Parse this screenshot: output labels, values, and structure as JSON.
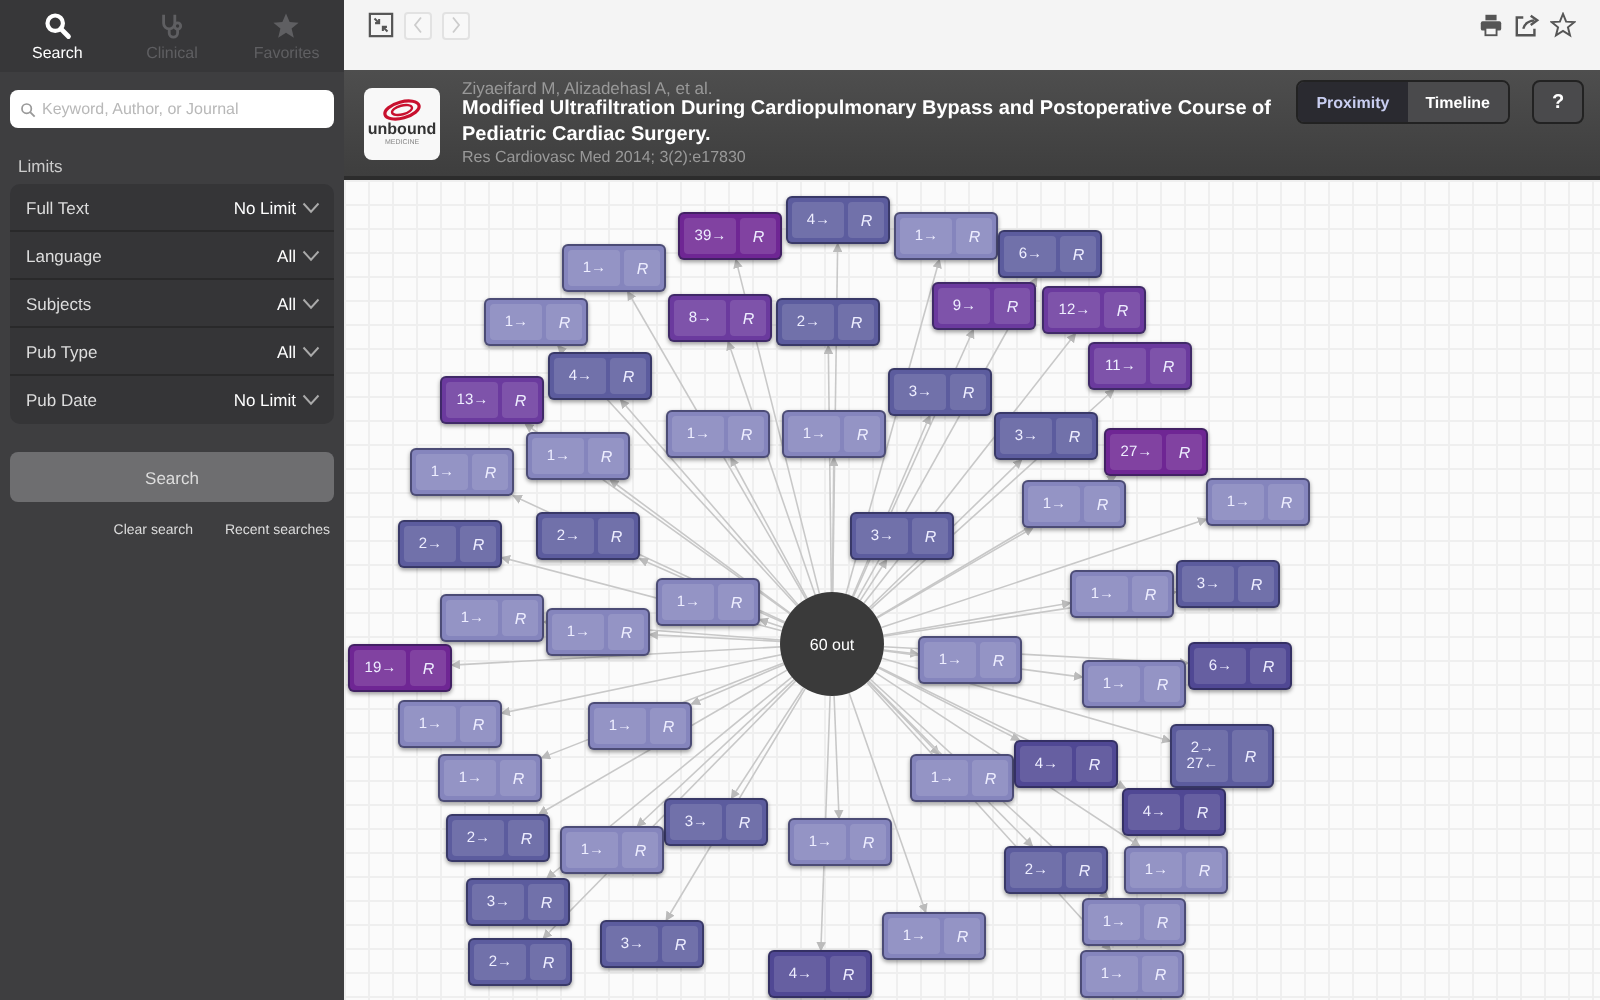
{
  "sidebar": {
    "tabs": [
      {
        "label": "Search",
        "kind": "search",
        "selected": true
      },
      {
        "label": "Clinical",
        "kind": "clinical",
        "selected": false
      },
      {
        "label": "Favorites",
        "kind": "favorites",
        "selected": false
      }
    ],
    "search_field": {
      "placeholder": "Keyword, Author, or Journal"
    },
    "limits_heading": "Limits",
    "limits": [
      {
        "label": "Full Text",
        "value": "No Limit"
      },
      {
        "label": "Language",
        "value": "All"
      },
      {
        "label": "Subjects",
        "value": "All"
      },
      {
        "label": "Pub Type",
        "value": "All"
      },
      {
        "label": "Pub Date",
        "value": "No Limit"
      }
    ],
    "search_button": "Search",
    "links": [
      "Clear search",
      "Recent searches"
    ]
  },
  "toolbar": {
    "nav": [
      {
        "kind": "back",
        "disabled": true
      },
      {
        "kind": "forward",
        "disabled": true
      }
    ]
  },
  "article": {
    "logo": {
      "name": "unbound",
      "tagline": "MEDICINE"
    },
    "authors": "Ziyaeifard M, Alizadehasl A, et al.",
    "title": "Modified Ultrafiltration During Cardiopulmonary Bypass and Postoperative Course of Pediatric Cardiac Surgery.",
    "citation": "Res Cardiovasc Med 2014; 3(2):e17830"
  },
  "view_modes": [
    {
      "label": "Proximity",
      "selected": true
    },
    {
      "label": "Timeline",
      "selected": false
    }
  ],
  "help": "?",
  "graph": {
    "center": "60 out",
    "nodes": [
      {
        "counts": [
          "39→"
        ],
        "action": "R",
        "color": "#6f2694"
      },
      {
        "counts": [
          "4→"
        ],
        "action": "R",
        "color": "#5c5c9e"
      },
      {
        "counts": [
          "1→"
        ],
        "action": "R",
        "color": "#8585bd"
      },
      {
        "counts": [
          "6→"
        ],
        "action": "R",
        "color": "#5c5c9e"
      },
      {
        "counts": [
          "1→"
        ],
        "action": "R",
        "color": "#8585bd"
      },
      {
        "counts": [
          "8→"
        ],
        "action": "R",
        "color": "#6b3a9e"
      },
      {
        "counts": [
          "2→"
        ],
        "action": "R",
        "color": "#5c5c9e"
      },
      {
        "counts": [
          "9→"
        ],
        "action": "R",
        "color": "#6b3a9e"
      },
      {
        "counts": [
          "12→"
        ],
        "action": "R",
        "color": "#6b3a9e"
      },
      {
        "counts": [
          "1→"
        ],
        "action": "R",
        "color": "#8585bd"
      },
      {
        "counts": [
          "4→"
        ],
        "action": "R",
        "color": "#5c5c9e"
      },
      {
        "counts": [
          "11→"
        ],
        "action": "R",
        "color": "#6b3a9e"
      },
      {
        "counts": [
          "13→"
        ],
        "action": "R",
        "color": "#6b3a9e"
      },
      {
        "counts": [
          "3→"
        ],
        "action": "R",
        "color": "#5c5c9e"
      },
      {
        "counts": [
          "1→"
        ],
        "action": "R",
        "color": "#8585bd"
      },
      {
        "counts": [
          "1→"
        ],
        "action": "R",
        "color": "#8585bd"
      },
      {
        "counts": [
          "3→"
        ],
        "action": "R",
        "color": "#5c5c9e"
      },
      {
        "counts": [
          "27→"
        ],
        "action": "R",
        "color": "#6f2694"
      },
      {
        "counts": [
          "1→"
        ],
        "action": "R",
        "color": "#8585bd"
      },
      {
        "counts": [
          "1→"
        ],
        "action": "R",
        "color": "#8585bd"
      },
      {
        "counts": [
          "1→"
        ],
        "action": "R",
        "color": "#8585bd"
      },
      {
        "counts": [
          "1→"
        ],
        "action": "R",
        "color": "#8585bd"
      },
      {
        "counts": [
          "2→"
        ],
        "action": "R",
        "color": "#5c5c9e"
      },
      {
        "counts": [
          "2→"
        ],
        "action": "R",
        "color": "#5c5c9e"
      },
      {
        "counts": [
          "3→"
        ],
        "action": "R",
        "color": "#5c5c9e"
      },
      {
        "counts": [
          "1→"
        ],
        "action": "R",
        "color": "#8585bd"
      },
      {
        "counts": [
          "3→"
        ],
        "action": "R",
        "color": "#5c5c9e"
      },
      {
        "counts": [
          "1→"
        ],
        "action": "R",
        "color": "#8585bd"
      },
      {
        "counts": [
          "1→"
        ],
        "action": "R",
        "color": "#8585bd"
      },
      {
        "counts": [
          "1→"
        ],
        "action": "R",
        "color": "#8585bd"
      },
      {
        "counts": [
          "19→"
        ],
        "action": "R",
        "color": "#6f2694"
      },
      {
        "counts": [
          "1→"
        ],
        "action": "R",
        "color": "#8585bd"
      },
      {
        "counts": [
          "6→"
        ],
        "action": "R",
        "color": "#504894"
      },
      {
        "counts": [
          "1→"
        ],
        "action": "R",
        "color": "#8585bd"
      },
      {
        "counts": [
          "1→"
        ],
        "action": "R",
        "color": "#8585bd"
      },
      {
        "counts": [
          "1→"
        ],
        "action": "R",
        "color": "#8585bd"
      },
      {
        "counts": [
          "2→",
          "27←"
        ],
        "action": "R",
        "color": "#5c5c9e"
      },
      {
        "counts": [
          "1→"
        ],
        "action": "R",
        "color": "#8585bd"
      },
      {
        "counts": [
          "1→"
        ],
        "action": "R",
        "color": "#8585bd"
      },
      {
        "counts": [
          "4→"
        ],
        "action": "R",
        "color": "#504894"
      },
      {
        "counts": [
          "3→"
        ],
        "action": "R",
        "color": "#5c5c9e"
      },
      {
        "counts": [
          "4→"
        ],
        "action": "R",
        "color": "#504894"
      },
      {
        "counts": [
          "2→"
        ],
        "action": "R",
        "color": "#5c5c9e"
      },
      {
        "counts": [
          "1→"
        ],
        "action": "R",
        "color": "#8585bd"
      },
      {
        "counts": [
          "1→"
        ],
        "action": "R",
        "color": "#8585bd"
      },
      {
        "counts": [
          "2→"
        ],
        "action": "R",
        "color": "#5c5c9e"
      },
      {
        "counts": [
          "1→"
        ],
        "action": "R",
        "color": "#8585bd"
      },
      {
        "counts": [
          "3→"
        ],
        "action": "R",
        "color": "#5c5c9e"
      },
      {
        "counts": [
          "1→"
        ],
        "action": "R",
        "color": "#8585bd"
      },
      {
        "counts": [
          "1→"
        ],
        "action": "R",
        "color": "#8585bd"
      },
      {
        "counts": [
          "2→"
        ],
        "action": "R",
        "color": "#5c5c9e"
      },
      {
        "counts": [
          "3→"
        ],
        "action": "R",
        "color": "#5c5c9e"
      },
      {
        "counts": [
          "4→"
        ],
        "action": "R",
        "color": "#504894"
      },
      {
        "counts": [
          "1→"
        ],
        "action": "R",
        "color": "#8585bd"
      }
    ]
  }
}
